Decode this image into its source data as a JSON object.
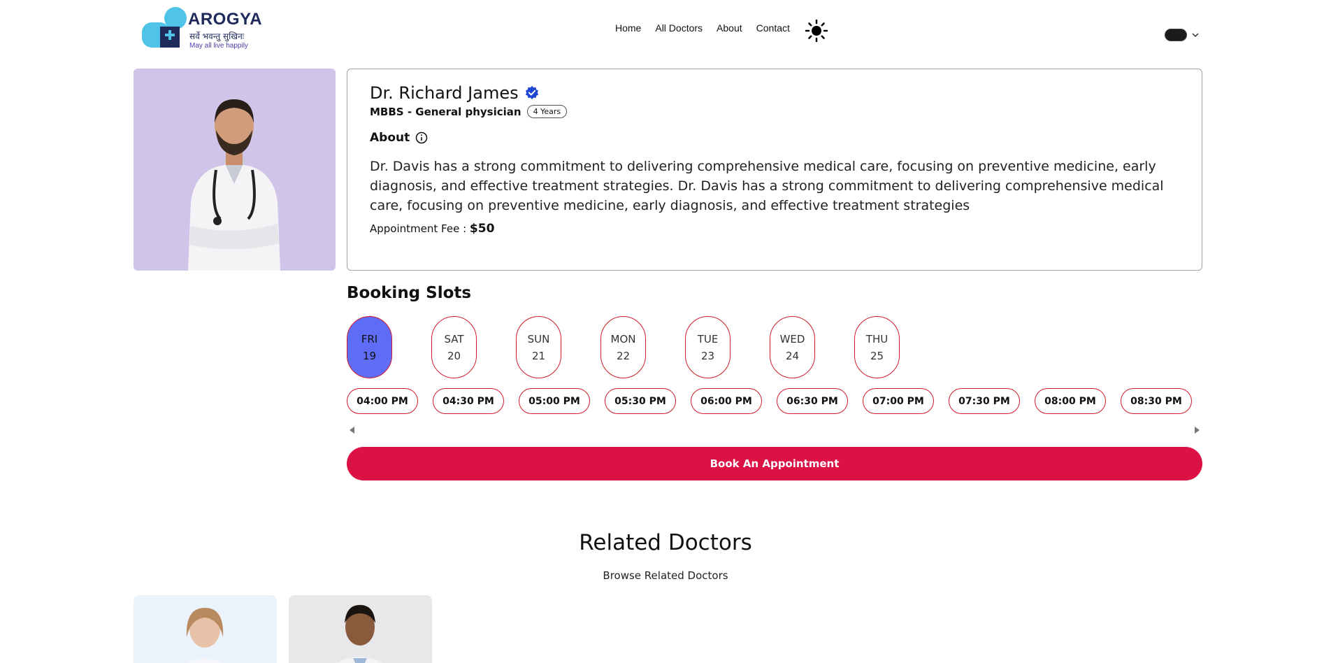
{
  "header": {
    "logo": {
      "title": "AROGYA",
      "sanskrit": "सर्वे भवन्तु सुखिनः",
      "tagline": "May all live happily"
    },
    "nav": [
      "Home",
      "All Doctors",
      "About",
      "Contact"
    ],
    "theme_icon": "sun-icon"
  },
  "doctor": {
    "name": "Dr. Richard James",
    "verified_icon": "verified-badge-icon",
    "degree": "MBBS - General physician",
    "experience": "4 Years",
    "about_label": "About",
    "about_text": "Dr. Davis has a strong commitment to delivering comprehensive medical care, focusing on preventive medicine, early diagnosis, and effective treatment strategies. Dr. Davis has a strong commitment to delivering comprehensive medical care, focusing on preventive medicine, early diagnosis, and effective treatment strategies",
    "fee_label": "Appointment Fee :",
    "fee_value": "$50"
  },
  "booking": {
    "title": "Booking Slots",
    "days": [
      {
        "day": "FRI",
        "date": "19"
      },
      {
        "day": "SAT",
        "date": "20"
      },
      {
        "day": "SUN",
        "date": "21"
      },
      {
        "day": "MON",
        "date": "22"
      },
      {
        "day": "TUE",
        "date": "23"
      },
      {
        "day": "WED",
        "date": "24"
      },
      {
        "day": "THU",
        "date": "25"
      }
    ],
    "times": [
      "04:00 PM",
      "04:30 PM",
      "05:00 PM",
      "05:30 PM",
      "06:00 PM",
      "06:30 PM",
      "07:00 PM",
      "07:30 PM",
      "08:00 PM",
      "08:30 PM"
    ],
    "button_label": "Book An Appointment"
  },
  "related": {
    "title": "Related Doctors",
    "subtitle": "Browse Related Doctors"
  },
  "colors": {
    "accent": "#dc1244",
    "selected_day": "#5f6cf6",
    "photo_bg": "#d1c4e9"
  }
}
